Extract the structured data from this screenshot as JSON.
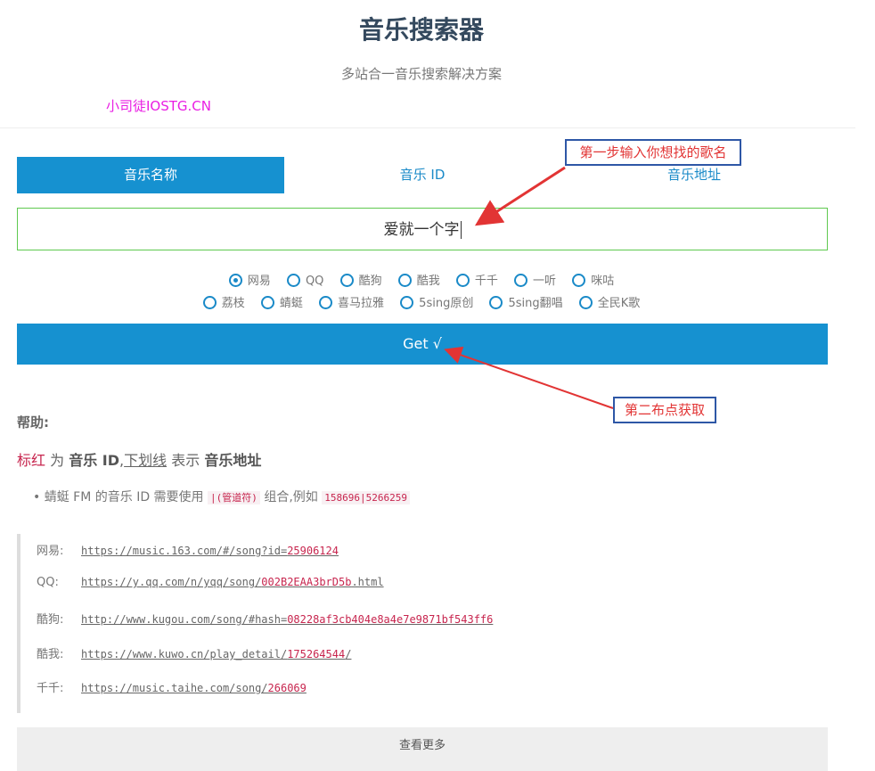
{
  "header": {
    "title": "音乐搜索器",
    "subtitle": "多站合一音乐搜索解决方案",
    "watermark": "小司徒IOSTG.CN"
  },
  "tabs": [
    {
      "label": "音乐名称",
      "active": true
    },
    {
      "label": "音乐 ID",
      "active": false
    },
    {
      "label": "音乐地址",
      "active": false
    }
  ],
  "search": {
    "value": "爱就一个字"
  },
  "sources_row1": [
    {
      "label": "网易",
      "checked": true
    },
    {
      "label": "QQ",
      "checked": false
    },
    {
      "label": "酷狗",
      "checked": false
    },
    {
      "label": "酷我",
      "checked": false
    },
    {
      "label": "千千",
      "checked": false
    },
    {
      "label": "一听",
      "checked": false
    },
    {
      "label": "咪咕",
      "checked": false
    }
  ],
  "sources_row2": [
    {
      "label": "荔枝",
      "checked": false
    },
    {
      "label": "蜻蜓",
      "checked": false
    },
    {
      "label": "喜马拉雅",
      "checked": false
    },
    {
      "label": "5sing原创",
      "checked": false
    },
    {
      "label": "5sing翻唱",
      "checked": false
    },
    {
      "label": "全民K歌",
      "checked": false
    }
  ],
  "get_button": "Get √",
  "help": {
    "title": "帮助:",
    "red_word": "标红",
    "t1": " 为 ",
    "bold1": "音乐 ID",
    "t2": ",",
    "underline_word": "下划线",
    "t3": " 表示 ",
    "bold2": "音乐地址",
    "bullet_a": "蜻蜓 FM 的音乐 ID 需要使用",
    "bullet_code1": "|(管道符)",
    "bullet_b": "组合,例如",
    "bullet_code2": "158696|5266259"
  },
  "examples": [
    {
      "label": "网易:",
      "prefix": "https://music.163.com/#/song?id=",
      "id": "25906124",
      "suffix": ""
    },
    {
      "label": "QQ:",
      "prefix": "https://y.qq.com/n/yqq/song/",
      "id": "002B2EAA3brD5b",
      "suffix": ".html"
    },
    {
      "label": "酷狗:",
      "prefix": "http://www.kugou.com/song/#hash=",
      "id": "08228af3cb404e8a4e7e9871bf543ff6",
      "suffix": ""
    },
    {
      "label": "酷我:",
      "prefix": "https://www.kuwo.cn/play_detail/",
      "id": "175264544",
      "suffix": "/"
    },
    {
      "label": "千千:",
      "prefix": "https://music.taihe.com/song/",
      "id": "266069",
      "suffix": ""
    }
  ],
  "more_button": "查看更多",
  "annotations": {
    "step1": "第一步输入你想找的歌名",
    "step2": "第二布点获取"
  },
  "colors": {
    "primary": "#1691d0",
    "accent_red": "#c7254e",
    "input_border": "#5fc94f",
    "annotation_red": "#e23434",
    "annotation_border": "#2e57a6"
  }
}
